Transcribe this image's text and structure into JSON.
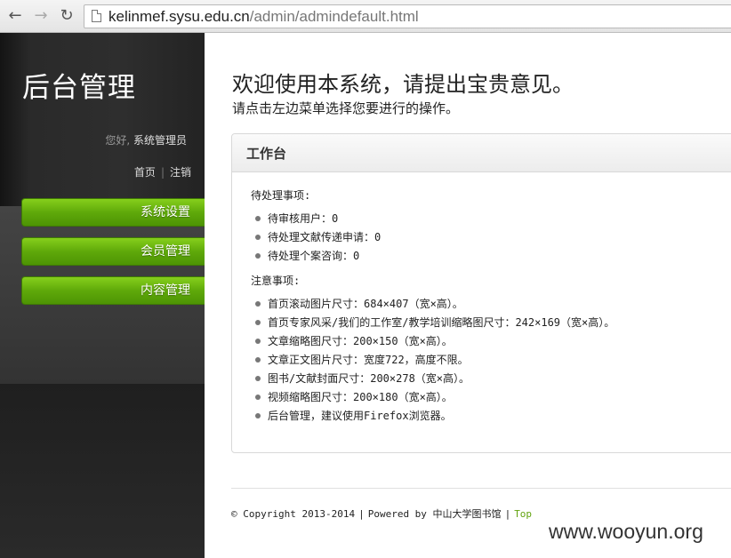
{
  "browser": {
    "url_host": "kelinmef.sysu.edu.cn",
    "url_path": "/admin/admindefault.html",
    "icons": [
      "back-arrow-icon",
      "forward-arrow-icon",
      "reload-icon",
      "page-icon"
    ]
  },
  "sidebar": {
    "title": "后台管理",
    "greeting_prefix": "您好,",
    "username": "系统管理员",
    "links": [
      "首页",
      "注销"
    ],
    "menu": [
      {
        "label": "系统设置"
      },
      {
        "label": "会员管理"
      },
      {
        "label": "内容管理"
      }
    ],
    "menu_color": "#5fa90a"
  },
  "main": {
    "welcome_title": "欢迎使用本系统，请提出宝贵意见。",
    "welcome_subtitle": "请点击左边菜单选择您要进行的操作。",
    "panel_title": "工作台",
    "pending_label": "待处理事项:",
    "pending_items": [
      "待审核用户：0",
      "待处理文献传递申请：0",
      "待处理个案咨询：0"
    ],
    "notes_label": "注意事项:",
    "notes_items": [
      "首页滚动图片尺寸：684×407（宽×高）。",
      "首页专家风采/我们的工作室/教学培训缩略图尺寸：242×169（宽×高）。",
      "文章缩略图尺寸：200×150（宽×高）。",
      "文章正文图片尺寸：宽度722，高度不限。",
      "图书/文献封面尺寸：200×278（宽×高）。",
      "视频缩略图尺寸：200×180（宽×高）。",
      "后台管理，建议使用Firefox浏览器。"
    ]
  },
  "footer": {
    "copyright": "© Copyright 2013-2014",
    "powered": "Powered by 中山大学图书馆",
    "top_link": "Top"
  },
  "watermark": "www.wooyun.org"
}
